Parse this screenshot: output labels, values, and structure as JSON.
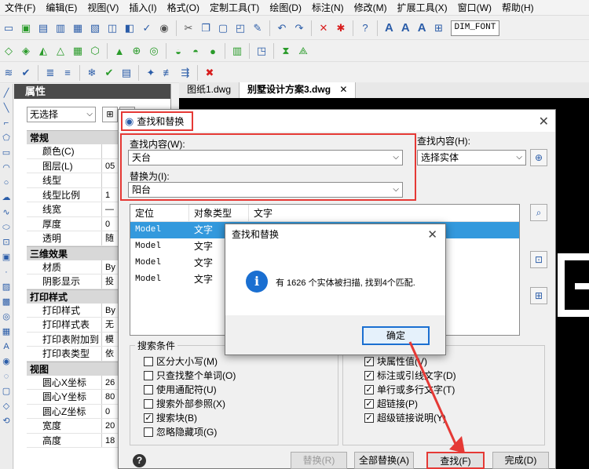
{
  "menu": [
    "文件(F)",
    "编辑(E)",
    "视图(V)",
    "插入(I)",
    "格式(O)",
    "定制工具(T)",
    "绘图(D)",
    "标注(N)",
    "修改(M)",
    "扩展工具(X)",
    "窗口(W)",
    "帮助(H)"
  ],
  "toolbar": {
    "font_letters": [
      "A",
      "A",
      "A"
    ],
    "dim_font": "DIM_FONT"
  },
  "properties": {
    "title": "属性",
    "selection": "无选择",
    "categories": [
      {
        "name": "常规",
        "rows": [
          {
            "key": "颜色(C)",
            "value": ""
          },
          {
            "key": "图层(L)",
            "value": "05"
          },
          {
            "key": "线型",
            "value": ""
          },
          {
            "key": "线型比例",
            "value": "1"
          },
          {
            "key": "线宽",
            "value": "—"
          },
          {
            "key": "厚度",
            "value": "0"
          },
          {
            "key": "透明",
            "value": "随"
          }
        ]
      },
      {
        "name": "三维效果",
        "rows": [
          {
            "key": "材质",
            "value": "By"
          },
          {
            "key": "阴影显示",
            "value": "投"
          }
        ]
      },
      {
        "name": "打印样式",
        "rows": [
          {
            "key": "打印样式",
            "value": "By"
          },
          {
            "key": "打印样式表",
            "value": "无"
          },
          {
            "key": "打印表附加到",
            "value": "模"
          },
          {
            "key": "打印表类型",
            "value": "依"
          }
        ]
      },
      {
        "name": "视图",
        "rows": [
          {
            "key": "圆心X坐标",
            "value": "26"
          },
          {
            "key": "圆心Y坐标",
            "value": "80"
          },
          {
            "key": "圆心Z坐标",
            "value": "0"
          },
          {
            "key": "宽度",
            "value": "20"
          },
          {
            "key": "高度",
            "value": "18"
          }
        ]
      }
    ]
  },
  "drawing_tabs": [
    "图纸1.dwg",
    "别墅设计方案3.dwg"
  ],
  "dialog": {
    "title": "查找和替换",
    "find_label": "查找内容(W):",
    "find_value": "天台",
    "replace_label": "替换为(I):",
    "replace_value": "阳台",
    "scope_label": "查找内容(H):",
    "scope_value": "选择实体",
    "columns": [
      "定位",
      "对象类型",
      "文字"
    ],
    "rows": [
      {
        "location": "Model",
        "type": "文字"
      },
      {
        "location": "Model",
        "type": "文字"
      },
      {
        "location": "Model",
        "type": "文字"
      },
      {
        "location": "Model",
        "type": "文字"
      }
    ],
    "search_conditions_label": "搜索条件",
    "left_options": [
      {
        "label": "区分大小写(M)",
        "checked": false
      },
      {
        "label": "只查找整个单词(O)",
        "checked": false
      },
      {
        "label": "使用通配符(U)",
        "checked": false
      },
      {
        "label": "搜索外部参照(X)",
        "checked": false
      },
      {
        "label": "搜索块(B)",
        "checked": true
      },
      {
        "label": "忽略隐藏项(G)",
        "checked": false
      }
    ],
    "right_options": [
      {
        "label": "块属性值(V)",
        "checked": true
      },
      {
        "label": "标注或引线文字(D)",
        "checked": true
      },
      {
        "label": "单行或多行文字(T)",
        "checked": true
      },
      {
        "label": "超链接(P)",
        "checked": true
      },
      {
        "label": "超级链接说明(Y)",
        "checked": true
      }
    ],
    "buttons": {
      "replace": "替换(R)",
      "replace_all": "全部替换(A)",
      "find": "查找(F)",
      "done": "完成(D)"
    }
  },
  "popup": {
    "title": "查找和替换",
    "message": "有 1626 个实体被扫描, 找到4个匹配.",
    "ok": "确定"
  }
}
